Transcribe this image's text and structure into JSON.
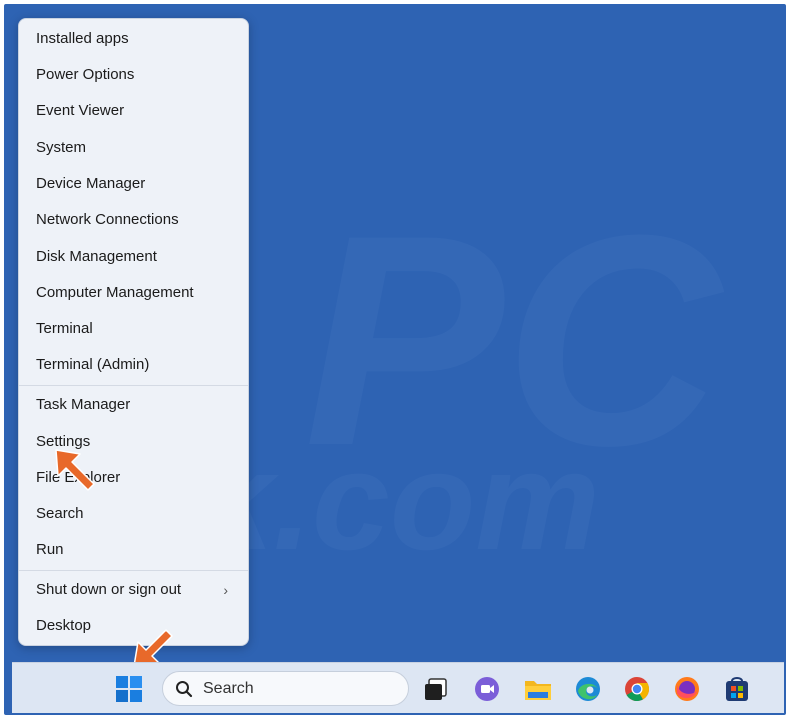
{
  "watermark": {
    "line1": "PC",
    "line2": "risk.com"
  },
  "context_menu": {
    "group1": [
      {
        "id": "installed-apps",
        "label": "Installed apps"
      },
      {
        "id": "power-options",
        "label": "Power Options"
      },
      {
        "id": "event-viewer",
        "label": "Event Viewer"
      },
      {
        "id": "system",
        "label": "System"
      },
      {
        "id": "device-manager",
        "label": "Device Manager"
      },
      {
        "id": "network-connections",
        "label": "Network Connections"
      },
      {
        "id": "disk-management",
        "label": "Disk Management"
      },
      {
        "id": "computer-management",
        "label": "Computer Management"
      },
      {
        "id": "terminal",
        "label": "Terminal"
      },
      {
        "id": "terminal-admin",
        "label": "Terminal (Admin)"
      }
    ],
    "group2": [
      {
        "id": "task-manager",
        "label": "Task Manager"
      },
      {
        "id": "settings",
        "label": "Settings"
      },
      {
        "id": "file-explorer",
        "label": "File Explorer"
      },
      {
        "id": "search",
        "label": "Search"
      },
      {
        "id": "run",
        "label": "Run"
      }
    ],
    "group3": [
      {
        "id": "shut-down",
        "label": "Shut down or sign out",
        "submenu": "›"
      },
      {
        "id": "desktop",
        "label": "Desktop"
      }
    ]
  },
  "taskbar": {
    "search_placeholder": "Search",
    "icons": [
      "windows-start-icon",
      "task-view-icon",
      "meet-chat-icon",
      "file-explorer-icon",
      "edge-icon",
      "chrome-icon",
      "firefox-icon",
      "store-icon"
    ]
  },
  "colors": {
    "desktop": "#2e63b3",
    "menu_bg": "#eef2f8",
    "taskbar_bg": "#dde6f3",
    "arrow": "#e8692a",
    "windows_blue": "#1a7ee0"
  }
}
